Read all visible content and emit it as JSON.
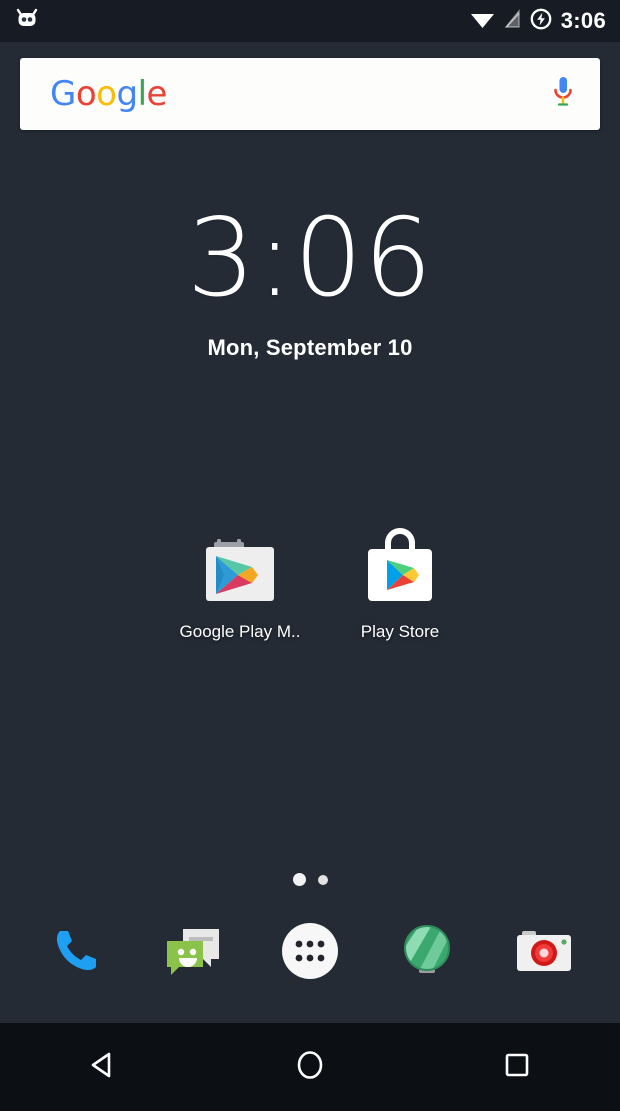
{
  "statusbar": {
    "rom_icon": "cyanogenmod-head-icon",
    "wifi_icon": "wifi-icon",
    "signal_icon": "signal-icon",
    "battery_icon": "battery-charging-icon",
    "time": "3:06"
  },
  "search": {
    "logo_text": [
      "G",
      "o",
      "o",
      "g",
      "l",
      "e"
    ],
    "mic_icon": "microphone-icon"
  },
  "clock_widget": {
    "time": "3:06",
    "date": "Mon, September 10"
  },
  "apps": [
    {
      "label": "Google Play M..",
      "icon": "google-play-music-icon"
    },
    {
      "label": "Play Store",
      "icon": "play-store-icon"
    }
  ],
  "page_indicator": {
    "total": 2,
    "active": 1
  },
  "dock": [
    {
      "name": "phone",
      "icon": "phone-icon"
    },
    {
      "name": "messaging",
      "icon": "messaging-icon"
    },
    {
      "name": "app-drawer",
      "icon": "app-drawer-icon"
    },
    {
      "name": "browser",
      "icon": "browser-globe-icon"
    },
    {
      "name": "camera",
      "icon": "camera-icon"
    }
  ],
  "navbar": [
    {
      "name": "back",
      "icon": "back-triangle-icon"
    },
    {
      "name": "home",
      "icon": "home-circle-icon"
    },
    {
      "name": "recents",
      "icon": "recents-square-icon"
    }
  ],
  "colors": {
    "wallpaper_teal": "#48bfcb",
    "wallpaper_red": "#e8334b",
    "wallpaper_dark": "#232a34",
    "accent_blue": "#4285f4"
  }
}
